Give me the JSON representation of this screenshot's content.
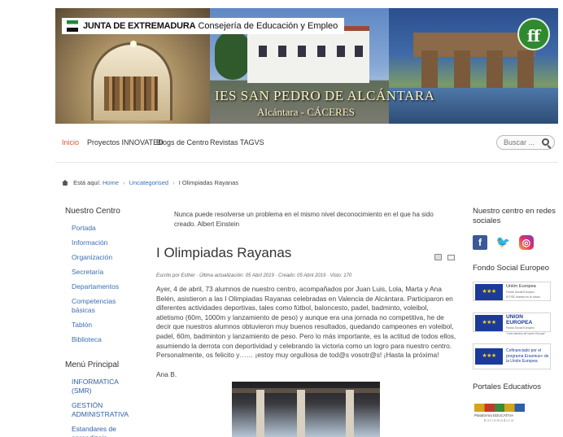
{
  "banner": {
    "junta_bold": "JUNTA DE EXTREMADURA",
    "junta_rest": "Consejería de Educación y Empleo",
    "school_title": "IES SAN PEDRO DE ALCÁNTARA",
    "school_sub": "Alcántara - CÁCERES"
  },
  "nav": {
    "items": [
      "Inicio",
      "Proyectos INNOVATED",
      "Blogs de Centro",
      "Revistas TAGVS"
    ],
    "search_placeholder": "Buscar ..."
  },
  "breadcrumb": {
    "prefix": "Está aquí:",
    "items": [
      "Home",
      "Uncategorised",
      "I Olimpiadas Rayanas"
    ]
  },
  "left": {
    "section1_title": "Nuestro Centro",
    "section1_links": [
      "Portada",
      "Información",
      "Organización",
      "Secretaría",
      "Departamentos",
      "Competencias básicas",
      "Tablón",
      "Biblioteca"
    ],
    "section2_title": "Menú Principal",
    "section2_links": [
      "INFORMATICA (SMR)",
      "GESTIÓN ADMINISTRATIVA",
      "Estandares de aprendizaje"
    ]
  },
  "main": {
    "quote": "Nunca puede resolverse un problema en el mismo nivel deconocimiento en el que ha sido creado. Albert Einstein",
    "title": "I Olimpiadas Rayanas",
    "meta": "Escrito por Esther  ·  Última actualización: 05 Abril 2019  ·  Creado: 05 Abril 2019  ·  Visto: 170",
    "body": "Ayer, 4 de abril, 73 alumnos de nuestro centro, acompañados por Juan Luis, Lola, Marta y Ana Belén, asistieron a las I Olimpiadas Rayanas celebradas en Valencia de Alcántara. Participaron en diferentes actividades deportivas, tales como fútbol, baloncesto, padel, badminto, voleibol, atletismo (60m, 1000m y lanzamiento de peso) y aunque era una jornada no competitiva, he de decir que nuestros alumnos obtuvieron muy buenos resultados, quedando campeones en voleibol, padel, 60m, badminton y lanzamiento de peso. Pero lo más importante, es la actitud de todos ellos, asumiendo la derrota con deportividad y celebrando la victoria como un logro para nuestro centro.",
    "closing": "Personalmente, os felicito y…… ¡estoy muy orgullosa de tod@s vosotr@s! ¡Hasta la próxima!",
    "signature": "Ana B."
  },
  "right": {
    "social_title": "Nuestro centro en redes sociales",
    "social_icons": [
      "facebook-icon",
      "twitter-icon",
      "instagram-icon"
    ],
    "fse_title": "Fondo Social Europeo",
    "eu1_name": "Unión Europea",
    "eu1_line1": "Fondo Social Europeo",
    "eu1_line2": "El FSE invierte en tu futuro",
    "eu2_name": "UNION EUROPEA",
    "eu2_line1": "Fondo Social Europeo",
    "eu2_line2": "\"Una manera de hacer Europa\"",
    "erasmus_text": "Cofinanciado por el programa Erasmus+ de la Unión Europea",
    "portales_title": "Portales Educativos",
    "portal_logo_line1": "Plataforma EDUCATIVA",
    "portal_logo_line2": "Extremadura"
  },
  "colors": {
    "accent_active": "#d9582b",
    "link_blue": "#3a6fb5",
    "eu_blue": "#1b3a9a"
  }
}
